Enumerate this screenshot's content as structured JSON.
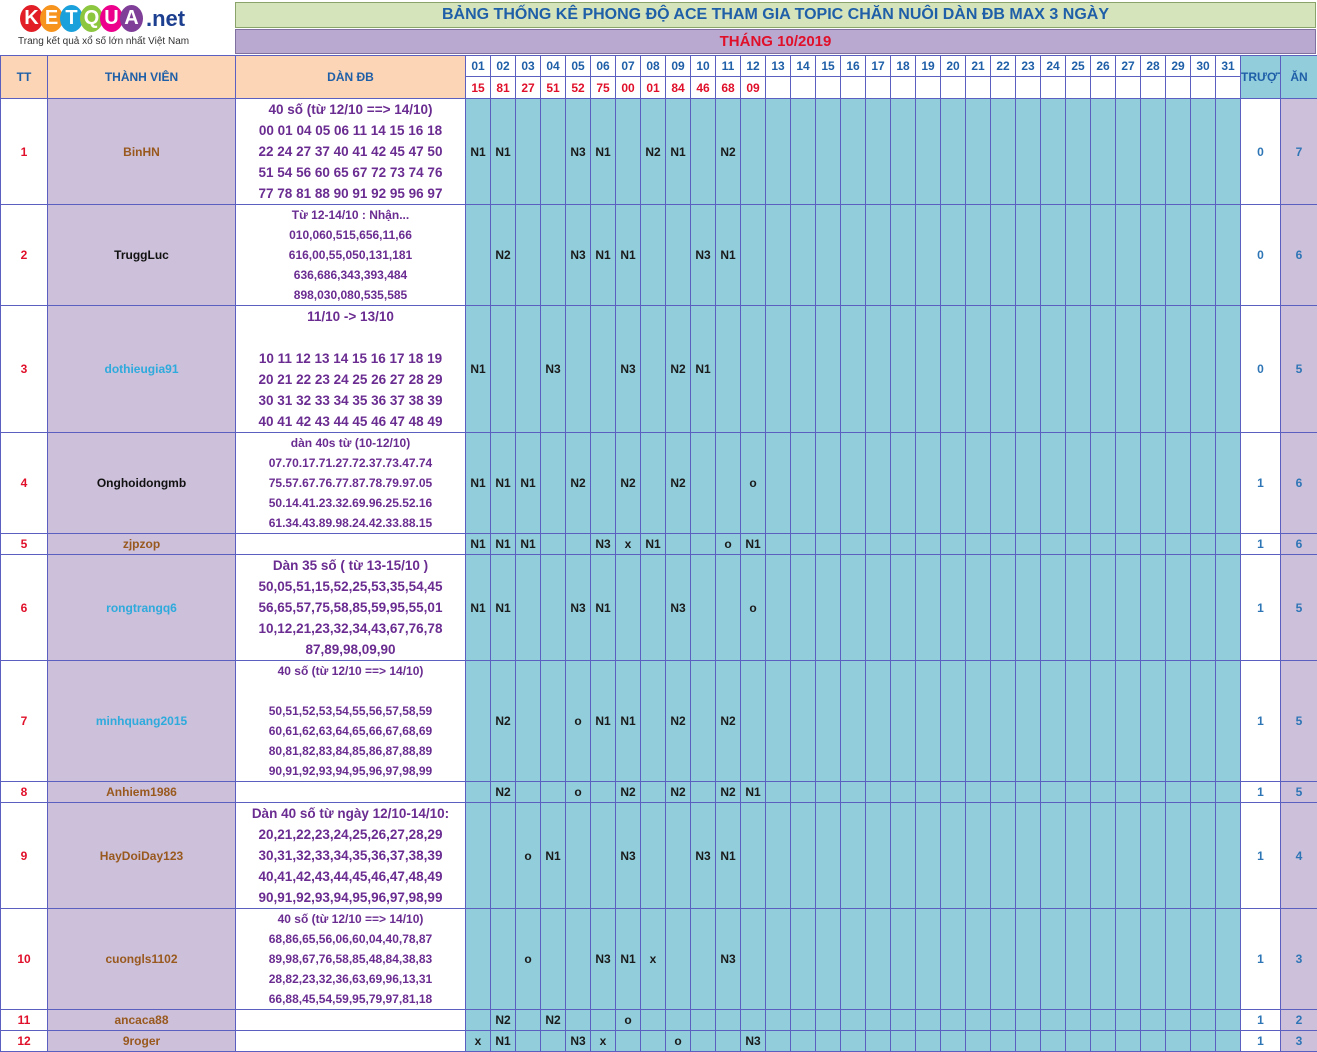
{
  "logo": {
    "letters": [
      "K",
      "E",
      "T",
      "Q",
      "U",
      "A"
    ],
    "letter_colors": [
      "#e21f26",
      "#f7941d",
      "#1aa0db",
      "#8dc63f",
      "#ec008c",
      "#7f3f98"
    ],
    "tld": ".net",
    "tagline": "Trang kết quả xổ số lớn nhất Việt Nam"
  },
  "title": "BẢNG THỐNG KÊ PHONG ĐỘ ACE THAM GIA TOPIC CHĂN NUÔI DÀN ĐB MAX 3 NGÀY",
  "month": "THÁNG 10/2019",
  "headers": {
    "tt": "TT",
    "member": "THÀNH VIÊN",
    "dan": "DÀN ĐB",
    "truot": "TRƯỢT",
    "an": "ĂN"
  },
  "days": [
    "01",
    "02",
    "03",
    "04",
    "05",
    "06",
    "07",
    "08",
    "09",
    "10",
    "11",
    "12",
    "13",
    "14",
    "15",
    "16",
    "17",
    "18",
    "19",
    "20",
    "21",
    "22",
    "23",
    "24",
    "25",
    "26",
    "27",
    "28",
    "29",
    "30",
    "31"
  ],
  "results": [
    "15",
    "81",
    "27",
    "51",
    "52",
    "75",
    "00",
    "01",
    "84",
    "46",
    "68",
    "09",
    "",
    "",
    "",
    "",
    "",
    "",
    "",
    "",
    "",
    "",
    "",
    "",
    "",
    "",
    "",
    "",
    "",
    "",
    ""
  ],
  "rows": [
    {
      "tt": "1",
      "name": "BinHN",
      "color": "#99591e",
      "big": true,
      "dan": [
        "40 số (từ 12/10 ==> 14/10)",
        "00 01 04 05 06 11 14 15 16 18",
        "22 24 27 37 40 41 42 45 47 50",
        "51 54 56 60 65 67 72 73 74 76",
        "77 78 81 88 90 91 92 95 96 97"
      ],
      "marks": [
        "N1",
        "N1",
        "",
        "",
        "N3",
        "N1",
        "",
        "N2",
        "N1",
        "",
        "N2",
        "",
        "",
        "",
        "",
        "",
        "",
        "",
        "",
        "",
        "",
        "",
        "",
        "",
        "",
        "",
        "",
        "",
        "",
        "",
        ""
      ],
      "truot": "0",
      "an": "7"
    },
    {
      "tt": "2",
      "name": "TruggLuc",
      "color": "#111111",
      "big": false,
      "dan": [
        "Từ 12-14/10 : Nhận...",
        "010,060,515,656,11,66",
        "616,00,55,050,131,181",
        "636,686,343,393,484",
        "898,030,080,535,585"
      ],
      "marks": [
        "",
        "N2",
        "",
        "",
        "N3",
        "N1",
        "N1",
        "",
        "",
        "N3",
        "N1",
        "",
        "",
        "",
        "",
        "",
        "",
        "",
        "",
        "",
        "",
        "",
        "",
        "",
        "",
        "",
        "",
        "",
        "",
        "",
        ""
      ],
      "truot": "0",
      "an": "6"
    },
    {
      "tt": "3",
      "name": "dothieugia91",
      "color": "#2eaadc",
      "big": true,
      "dan": [
        "11/10 -> 13/10",
        "",
        "10 11 12 13 14 15 16 17 18 19",
        "20 21 22 23 24 25 26 27 28 29",
        "30 31 32 33 34 35 36 37 38 39",
        "40 41 42 43 44 45 46 47 48 49"
      ],
      "marks": [
        "N1",
        "",
        "",
        "N3",
        "",
        "",
        "N3",
        "",
        "N2",
        "N1",
        "",
        "",
        "",
        "",
        "",
        "",
        "",
        "",
        "",
        "",
        "",
        "",
        "",
        "",
        "",
        "",
        "",
        "",
        "",
        "",
        ""
      ],
      "truot": "0",
      "an": "5"
    },
    {
      "tt": "4",
      "name": "Onghoidongmb",
      "color": "#111111",
      "big": false,
      "dan": [
        "dàn 40s từ (10-12/10)",
        "07.70.17.71.27.72.37.73.47.74",
        "75.57.67.76.77.87.78.79.97.05",
        "50.14.41.23.32.69.96.25.52.16",
        "61.34.43.89.98.24.42.33.88.15"
      ],
      "marks": [
        "N1",
        "N1",
        "N1",
        "",
        "N2",
        "",
        "N2",
        "",
        "N2",
        "",
        "",
        "o",
        "",
        "",
        "",
        "",
        "",
        "",
        "",
        "",
        "",
        "",
        "",
        "",
        "",
        "",
        "",
        "",
        "",
        "",
        ""
      ],
      "truot": "1",
      "an": "6"
    },
    {
      "tt": "5",
      "name": "zjpzop",
      "color": "#99591e",
      "big": false,
      "dan": [
        ""
      ],
      "marks": [
        "N1",
        "N1",
        "N1",
        "",
        "",
        "N3",
        "x",
        "N1",
        "",
        "",
        "o",
        "N1",
        "",
        "",
        "",
        "",
        "",
        "",
        "",
        "",
        "",
        "",
        "",
        "",
        "",
        "",
        "",
        "",
        "",
        "",
        ""
      ],
      "truot": "1",
      "an": "6"
    },
    {
      "tt": "6",
      "name": "rongtrangq6",
      "color": "#2eaadc",
      "big": true,
      "dan": [
        "Dàn 35 số ( từ 13-15/10 )",
        "50,05,51,15,52,25,53,35,54,45",
        "56,65,57,75,58,85,59,95,55,01",
        "10,12,21,23,32,34,43,67,76,78",
        "87,89,98,09,90"
      ],
      "marks": [
        "N1",
        "N1",
        "",
        "",
        "N3",
        "N1",
        "",
        "",
        "N3",
        "",
        "",
        "o",
        "",
        "",
        "",
        "",
        "",
        "",
        "",
        "",
        "",
        "",
        "",
        "",
        "",
        "",
        "",
        "",
        "",
        "",
        ""
      ],
      "truot": "1",
      "an": "5"
    },
    {
      "tt": "7",
      "name": "minhquang2015",
      "color": "#2eaadc",
      "big": false,
      "dan": [
        "40 số (từ 12/10 ==> 14/10)",
        "",
        "50,51,52,53,54,55,56,57,58,59",
        "60,61,62,63,64,65,66,67,68,69",
        "80,81,82,83,84,85,86,87,88,89",
        "90,91,92,93,94,95,96,97,98,99"
      ],
      "marks": [
        "",
        "N2",
        "",
        "",
        "o",
        "N1",
        "N1",
        "",
        "N2",
        "",
        "N2",
        "",
        "",
        "",
        "",
        "",
        "",
        "",
        "",
        "",
        "",
        "",
        "",
        "",
        "",
        "",
        "",
        "",
        "",
        "",
        ""
      ],
      "truot": "1",
      "an": "5"
    },
    {
      "tt": "8",
      "name": "Anhiem1986",
      "color": "#99591e",
      "big": false,
      "dan": [
        ""
      ],
      "marks": [
        "",
        "N2",
        "",
        "",
        "o",
        "",
        "N2",
        "",
        "N2",
        "",
        "N2",
        "N1",
        "",
        "",
        "",
        "",
        "",
        "",
        "",
        "",
        "",
        "",
        "",
        "",
        "",
        "",
        "",
        "",
        "",
        "",
        ""
      ],
      "truot": "1",
      "an": "5"
    },
    {
      "tt": "9",
      "name": "HayDoiDay123",
      "color": "#99591e",
      "big": true,
      "dan": [
        "Dàn 40 số từ ngày 12/10-14/10:",
        "20,21,22,23,24,25,26,27,28,29",
        "30,31,32,33,34,35,36,37,38,39",
        "40,41,42,43,44,45,46,47,48,49",
        "90,91,92,93,94,95,96,97,98,99"
      ],
      "marks": [
        "",
        "",
        "o",
        "N1",
        "",
        "",
        "N3",
        "",
        "",
        "N3",
        "N1",
        "",
        "",
        "",
        "",
        "",
        "",
        "",
        "",
        "",
        "",
        "",
        "",
        "",
        "",
        "",
        "",
        "",
        "",
        "",
        ""
      ],
      "truot": "1",
      "an": "4"
    },
    {
      "tt": "10",
      "name": "cuongls1102",
      "color": "#99591e",
      "big": false,
      "dan": [
        "40 số (từ 12/10 ==> 14/10)",
        "68,86,65,56,06,60,04,40,78,87",
        "89,98,67,76,58,85,48,84,38,83",
        "28,82,23,32,36,63,69,96,13,31",
        "66,88,45,54,59,95,79,97,81,18"
      ],
      "marks": [
        "",
        "",
        "o",
        "",
        "",
        "N3",
        "N1",
        "x",
        "",
        "",
        "N3",
        "",
        "",
        "",
        "",
        "",
        "",
        "",
        "",
        "",
        "",
        "",
        "",
        "",
        "",
        "",
        "",
        "",
        "",
        "",
        ""
      ],
      "truot": "1",
      "an": "3"
    },
    {
      "tt": "11",
      "name": "ancaca88",
      "color": "#99591e",
      "big": false,
      "dan": [
        ""
      ],
      "marks": [
        "",
        "N2",
        "",
        "N2",
        "",
        "",
        "o",
        "",
        "",
        "",
        "",
        "",
        "",
        "",
        "",
        "",
        "",
        "",
        "",
        "",
        "",
        "",
        "",
        "",
        "",
        "",
        "",
        "",
        "",
        "",
        ""
      ],
      "truot": "1",
      "an": "2"
    },
    {
      "tt": "12",
      "name": "9roger",
      "color": "#99591e",
      "big": false,
      "dan": [
        ""
      ],
      "marks": [
        "x",
        "N1",
        "",
        "",
        "N3",
        "x",
        "",
        "",
        "o",
        "",
        "",
        "N3",
        "",
        "",
        "",
        "",
        "",
        "",
        "",
        "",
        "",
        "",
        "",
        "",
        "",
        "",
        "",
        "",
        "",
        "",
        ""
      ],
      "truot": "1",
      "an": "3"
    }
  ]
}
